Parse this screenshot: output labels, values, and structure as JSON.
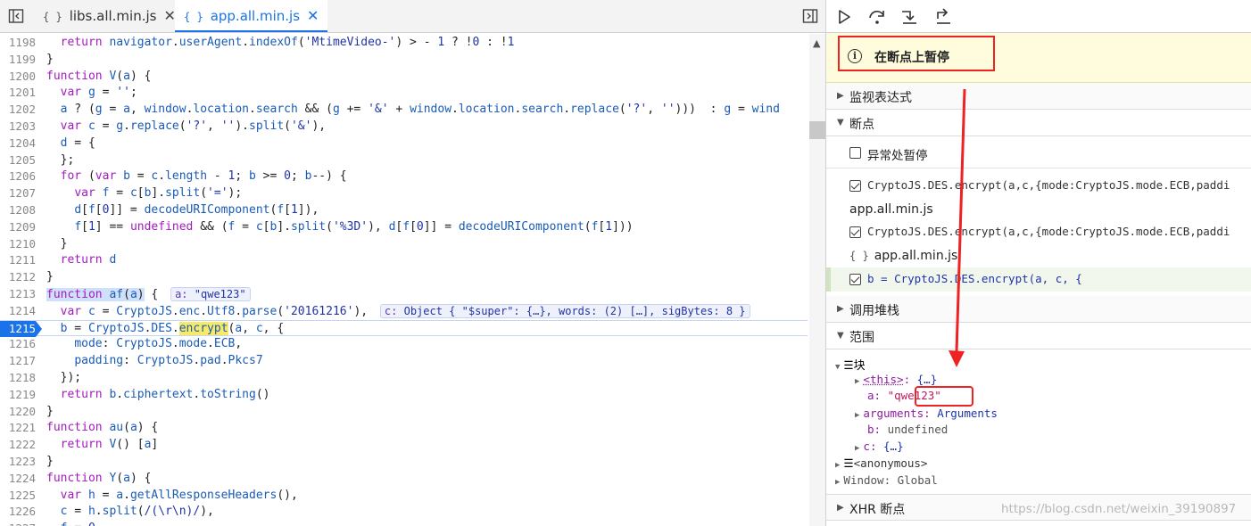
{
  "tabs": [
    {
      "label": "libs.all.min.js",
      "icon": "{ }",
      "close": "✕",
      "active": false
    },
    {
      "label": "app.all.min.js",
      "icon": "{ }",
      "close": "✕",
      "active": true
    }
  ],
  "code": {
    "lines": [
      {
        "no": "1198",
        "html": "  <span class='k'>return</span> <span class='p'>navigator</span>.<span class='p'>userAgent</span>.<span class='p'>indexOf</span>(<span class='s'>'MtimeVideo-'</span>) > - <span class='s'>1</span> ? !<span class='s'>0</span> : !<span class='s'>1</span>"
      },
      {
        "no": "1199",
        "html": "}"
      },
      {
        "no": "1200",
        "html": "<span class='k'>function</span> <span class='p'>V</span>(<span class='p'>a</span>) {"
      },
      {
        "no": "1201",
        "html": "  <span class='k'>var</span> <span class='p'>g</span> = <span class='s'>''</span>;"
      },
      {
        "no": "1202",
        "html": "  <span class='p'>a</span> ? (<span class='p'>g</span> = <span class='p'>a</span>, <span class='p'>window</span>.<span class='p'>location</span>.<span class='p'>search</span> && (<span class='p'>g</span> += <span class='s'>'&'</span> + <span class='p'>window</span>.<span class='p'>location</span>.<span class='p'>search</span>.<span class='p'>replace</span>(<span class='s'>'?'</span>, <span class='s'>''</span>)))  : <span class='p'>g</span> = <span class='p'>wind</span>"
      },
      {
        "no": "1203",
        "html": "  <span class='k'>var</span> <span class='p'>c</span> = <span class='p'>g</span>.<span class='p'>replace</span>(<span class='s'>'?'</span>, <span class='s'>''</span>).<span class='p'>split</span>(<span class='s'>'&'</span>),"
      },
      {
        "no": "1204",
        "html": "  <span class='p'>d</span> = {"
      },
      {
        "no": "1205",
        "html": "  };"
      },
      {
        "no": "1206",
        "html": "  <span class='k'>for</span> (<span class='k'>var</span> <span class='p'>b</span> = <span class='p'>c</span>.<span class='p'>length</span> - <span class='s'>1</span>; <span class='p'>b</span> >= <span class='s'>0</span>; <span class='p'>b</span>--) {"
      },
      {
        "no": "1207",
        "html": "    <span class='k'>var</span> <span class='p'>f</span> = <span class='p'>c</span>[<span class='p'>b</span>].<span class='p'>split</span>(<span class='s'>'='</span>);"
      },
      {
        "no": "1208",
        "html": "    <span class='p'>d</span>[<span class='p'>f</span>[<span class='s'>0</span>]] = <span class='p'>decodeURIComponent</span>(<span class='p'>f</span>[<span class='s'>1</span>]),"
      },
      {
        "no": "1209",
        "html": "    <span class='p'>f</span>[<span class='s'>1</span>] == <span class='k'>undefined</span> && (<span class='p'>f</span> = <span class='p'>c</span>[<span class='p'>b</span>].<span class='p'>split</span>(<span class='s'>'%3D'</span>), <span class='p'>d</span>[<span class='p'>f</span>[<span class='s'>0</span>]] = <span class='p'>decodeURIComponent</span>(<span class='p'>f</span>[<span class='s'>1</span>]))"
      },
      {
        "no": "1210",
        "html": "  }"
      },
      {
        "no": "1211",
        "html": "  <span class='k'>return</span> <span class='p'>d</span>"
      },
      {
        "no": "1212",
        "html": "}"
      },
      {
        "no": "1213",
        "html": "<span class='hl'><span class='k'>function</span> <span class='p'>af</span>(<span class='p'>a</span>)</span> { <span class='inline'>a: <b>\"qwe123\"</b></span>"
      },
      {
        "no": "1214",
        "html": "  <span class='k'>var</span> <span class='p'>c</span> = <span class='p'>CryptoJS</span>.<span class='p'>enc</span>.<span class='p'>Utf8</span>.<span class='p'>parse</span>(<span class='s'>'20161216'</span>), <span class='inline'>c: <b>Object { \"$super\": {…}, words: (2) […], sigBytes: 8 }</b></span>"
      },
      {
        "no": "1215",
        "html": "  <span class='p'>b</span> = <span class='p'>CryptoJS</span>.<span class='p'>DES</span>.<span class='hly'><span class='p'>encrypt</span></span>(<span class='p'>a</span>, <span class='p'>c</span>, {",
        "current": true
      },
      {
        "no": "1216",
        "html": "    <span class='p'>mode</span>: <span class='p'>CryptoJS</span>.<span class='p'>mode</span>.<span class='p'>ECB</span>,"
      },
      {
        "no": "1217",
        "html": "    <span class='p'>padding</span>: <span class='p'>CryptoJS</span>.<span class='p'>pad</span>.<span class='p'>Pkcs7</span>"
      },
      {
        "no": "1218",
        "html": "  });"
      },
      {
        "no": "1219",
        "html": "  <span class='k'>return</span> <span class='p'>b</span>.<span class='p'>ciphertext</span>.<span class='p'>toString</span>()"
      },
      {
        "no": "1220",
        "html": "}"
      },
      {
        "no": "1221",
        "html": "<span class='k'>function</span> <span class='p'>au</span>(<span class='p'>a</span>) {"
      },
      {
        "no": "1222",
        "html": "  <span class='k'>return</span> <span class='p'>V</span>() [<span class='p'>a</span>]"
      },
      {
        "no": "1223",
        "html": "}"
      },
      {
        "no": "1224",
        "html": "<span class='k'>function</span> <span class='p'>Y</span>(<span class='p'>a</span>) {"
      },
      {
        "no": "1225",
        "html": "  <span class='k'>var</span> <span class='p'>h</span> = <span class='p'>a</span>.<span class='p'>getAllResponseHeaders</span>(),"
      },
      {
        "no": "1226",
        "html": "  <span class='p'>c</span> = <span class='p'>h</span>.<span class='p'>split</span>(<span class='s'>/(\\r\\n)/</span>),"
      },
      {
        "no": "1227",
        "html": "  <span class='p'>f</span> = <span class='s'>0</span>,"
      }
    ]
  },
  "panel": {
    "paused_label": "在断点上暂停",
    "sections": {
      "watch": "监视表达式",
      "breakpoints": "断点",
      "callstack": "调用堆栈",
      "scope": "范围",
      "xhr": "XHR 断点"
    },
    "pause_on_exceptions": "异常处暂停",
    "bp1": "CryptoJS.DES.encrypt(a,c,{mode:CryptoJS.mode.ECB,paddi",
    "file_app": "app.all.min.js",
    "bp2": "CryptoJS.DES.encrypt(a,c,{mode:CryptoJS.mode.ECB,paddi",
    "file_app2": "app.all.min.js",
    "file_app2_icon": "{ }",
    "bp3": "b = CryptoJS.DES.encrypt(a, c, {",
    "scope": {
      "block": "块",
      "this_key": "<this>",
      "this_val": "{…}",
      "a_key": "a",
      "a_val": "\"qwe123\"",
      "args_key": "arguments",
      "args_val": "Arguments",
      "b_key": "b",
      "b_val": "undefined",
      "c_key": "c",
      "c_val": "{…}",
      "anon": "<anonymous>",
      "window": "Window: Global"
    }
  },
  "watermark": "https://blog.csdn.net/weixin_39190897",
  "colors": {
    "accent": "#1a73e8",
    "annotation": "#e22222",
    "paused_bg": "#fffbdd"
  }
}
